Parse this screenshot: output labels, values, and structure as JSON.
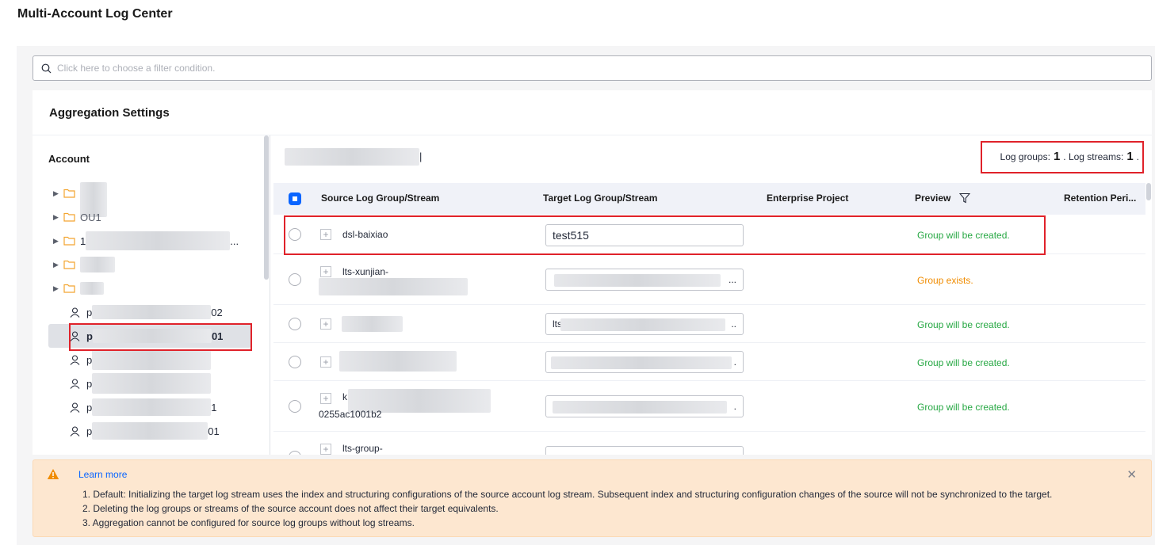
{
  "page": {
    "title": "Multi-Account Log Center"
  },
  "filter": {
    "placeholder": "Click here to choose a filter condition.",
    "icon": "search-icon"
  },
  "aggregation": {
    "title": "Aggregation Settings"
  },
  "account_panel": {
    "heading": "Account",
    "folders": [
      {
        "label": ""
      },
      {
        "label": "OU1"
      },
      {
        "label": "1",
        "suffix": "..."
      },
      {
        "label": ""
      },
      {
        "label": ""
      }
    ],
    "users": [
      {
        "prefix": "p",
        "suffix": "02",
        "selected": false
      },
      {
        "prefix": "p",
        "suffix": "01",
        "selected": true
      },
      {
        "prefix": "p",
        "suffix": "",
        "selected": false
      },
      {
        "prefix": "p",
        "suffix": "",
        "selected": false
      },
      {
        "prefix": "p",
        "suffix": "1",
        "selected": false
      },
      {
        "prefix": "p",
        "suffix": "01",
        "selected": false
      }
    ]
  },
  "summary": {
    "log_groups_label": "Log groups:",
    "log_groups_count": "1",
    "log_streams_label": ". Log streams:",
    "log_streams_count": "1",
    "end": "."
  },
  "table": {
    "headers": {
      "source": "Source Log Group/Stream",
      "target": "Target Log Group/Stream",
      "enterprise": "Enterprise Project",
      "preview": "Preview",
      "retention": "Retention Peri..."
    },
    "rows": [
      {
        "source": "dsl-baixiao",
        "target": "test515",
        "preview": "Group will be created."
      },
      {
        "source": "lts-xunjian-",
        "target_prefix": "",
        "target_suffix": "...",
        "preview": "Group exists."
      },
      {
        "source": "",
        "target_prefix": "lts",
        "target_suffix": "..",
        "preview": "Group will be created."
      },
      {
        "source": "",
        "target_prefix": "",
        "target_suffix": ".",
        "preview": "Group will be created."
      },
      {
        "source": "k",
        "source_line2": "0255ac1001b2",
        "target_prefix": "",
        "target_suffix": ".",
        "preview": "Group will be created."
      },
      {
        "source": "lts-group-"
      }
    ]
  },
  "alert": {
    "link": "Learn more",
    "lines": [
      "1. Default: Initializing the target log stream uses the index and structuring configurations of the source account log stream. Subsequent index and structuring configuration changes of the source will not be synchronized to the target.",
      "2. Deleting the log groups or streams of the source account does not affect their target equivalents.",
      "3. Aggregation cannot be configured for source log groups without log streams."
    ],
    "close": "✕"
  },
  "colors": {
    "accent": "#0a65ff",
    "success": "#27a844",
    "warning": "#f08c00",
    "highlight": "#e0222a",
    "alert_bg": "#fde7d0"
  }
}
